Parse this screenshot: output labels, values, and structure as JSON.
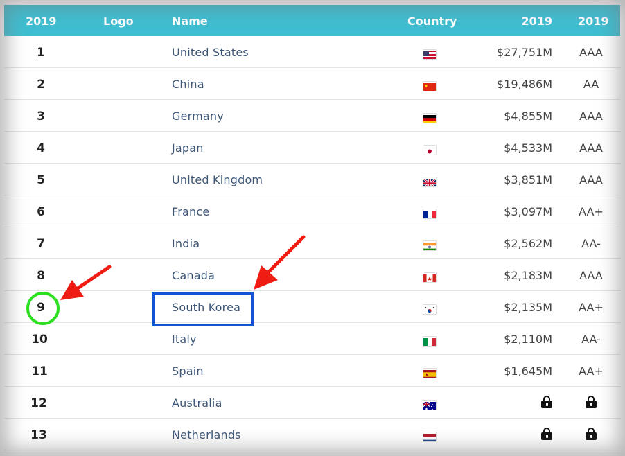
{
  "header": {
    "rank_col": "2019",
    "logo_col": "Logo",
    "name_col": "Name",
    "country_col": "Country",
    "value_col": "2019",
    "rating_col": "2019"
  },
  "rows": [
    {
      "rank": "1",
      "name": "United States",
      "flag": "us-flag",
      "value": "$27,751M",
      "rating": "AAA"
    },
    {
      "rank": "2",
      "name": "China",
      "flag": "cn-flag",
      "value": "$19,486M",
      "rating": "AA"
    },
    {
      "rank": "3",
      "name": "Germany",
      "flag": "de-flag",
      "value": "$4,855M",
      "rating": "AAA"
    },
    {
      "rank": "4",
      "name": "Japan",
      "flag": "jp-flag",
      "value": "$4,533M",
      "rating": "AAA"
    },
    {
      "rank": "5",
      "name": "United Kingdom",
      "flag": "gb-flag",
      "value": "$3,851M",
      "rating": "AAA"
    },
    {
      "rank": "6",
      "name": "France",
      "flag": "fr-flag",
      "value": "$3,097M",
      "rating": "AA+"
    },
    {
      "rank": "7",
      "name": "India",
      "flag": "in-flag",
      "value": "$2,562M",
      "rating": "AA-"
    },
    {
      "rank": "8",
      "name": "Canada",
      "flag": "ca-flag",
      "value": "$2,183M",
      "rating": "AAA"
    },
    {
      "rank": "9",
      "name": "South Korea",
      "flag": "kr-flag",
      "value": "$2,135M",
      "rating": "AA+"
    },
    {
      "rank": "10",
      "name": "Italy",
      "flag": "it-flag",
      "value": "$2,110M",
      "rating": "AA-"
    },
    {
      "rank": "11",
      "name": "Spain",
      "flag": "es-flag",
      "value": "$1,645M",
      "rating": "AA+"
    },
    {
      "rank": "12",
      "name": "Australia",
      "flag": "au-flag",
      "value": "",
      "rating": "",
      "locked": true
    },
    {
      "rank": "13",
      "name": "Netherlands",
      "flag": "nl-flag",
      "value": "",
      "rating": "",
      "locked": true
    }
  ],
  "annotations": {
    "highlight_rank": "9",
    "highlight_name": "South Korea",
    "circle_color": "#2ce01f",
    "box_color": "#1353d7",
    "arrow_color": "#ee1c13"
  },
  "colors": {
    "header_bg": "#3fbed1",
    "name_text": "#3d5677"
  }
}
